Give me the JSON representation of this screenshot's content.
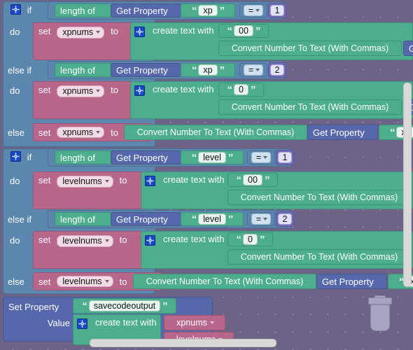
{
  "app": {
    "type": "visual-block-editor",
    "canvas_background": "#6d6387"
  },
  "colors": {
    "control": "#5b86ad",
    "set_variable": "#b8678b",
    "text": "#4cae8e",
    "property": "#5668ab",
    "math": "#6d6bb5",
    "trash": "#a9a3bf",
    "scrollbar": "#d9d9d9"
  },
  "labels": {
    "if": "if",
    "else_if": "else if",
    "else": "else",
    "do": "do",
    "set": "set",
    "to": "to",
    "length_of": "length of",
    "get_property": "Get Property",
    "set_property": "Set Property",
    "value": "Value",
    "create_text_with": "create text with",
    "convert_number": "Convert Number To Text (With Commas)",
    "equals": "="
  },
  "vars": {
    "xpnums": "xpnums",
    "levelnums": "levelnums"
  },
  "strings": {
    "xp": "xp",
    "level": "level",
    "two_zeros": "00",
    "one_zero": "0",
    "savecodeoutput": "savecodeoutput"
  },
  "numbers": {
    "one": "1",
    "two": "2"
  },
  "blocks": {
    "xp_if": {
      "branch1": {
        "cond_text": "xp",
        "cond_op": "=",
        "cond_num": "1",
        "set_var": "xpnums",
        "pad_string": "00",
        "convert": "Convert Number To Text (With Commas)"
      },
      "branch2": {
        "cond_text": "xp",
        "cond_op": "=",
        "cond_num": "2",
        "set_var": "xpnums",
        "pad_string": "0",
        "convert": "Convert Number To Text (With Commas)"
      },
      "else_branch": {
        "set_var": "xpnums",
        "convert": "Convert Number To Text (With Commas)",
        "get_property": "Get Property",
        "prop_name": "xp"
      }
    },
    "level_if": {
      "branch1": {
        "cond_text": "level",
        "cond_op": "=",
        "cond_num": "1",
        "set_var": "levelnums",
        "pad_string": "00",
        "convert": "Convert Number To Text (With Commas)"
      },
      "branch2": {
        "cond_text": "level",
        "cond_op": "=",
        "cond_num": "2",
        "set_var": "levelnums",
        "pad_string": "0",
        "convert": "Convert Number To Text (With Commas)"
      },
      "else_branch": {
        "set_var": "levelnums",
        "convert": "Convert Number To Text (With Commas)",
        "get_property": "Get Property",
        "prop_name": "xp"
      }
    },
    "set_property_block": {
      "title": "Set Property",
      "prop_name": "savecodeoutput",
      "value_label": "Value",
      "create_text": "create text with",
      "item1": "xpnums",
      "item2": "levelnums"
    }
  },
  "icons": {
    "mutator": "gear-icon",
    "trash": "trash-can-icon",
    "dropdown": "chevron-down-icon"
  }
}
